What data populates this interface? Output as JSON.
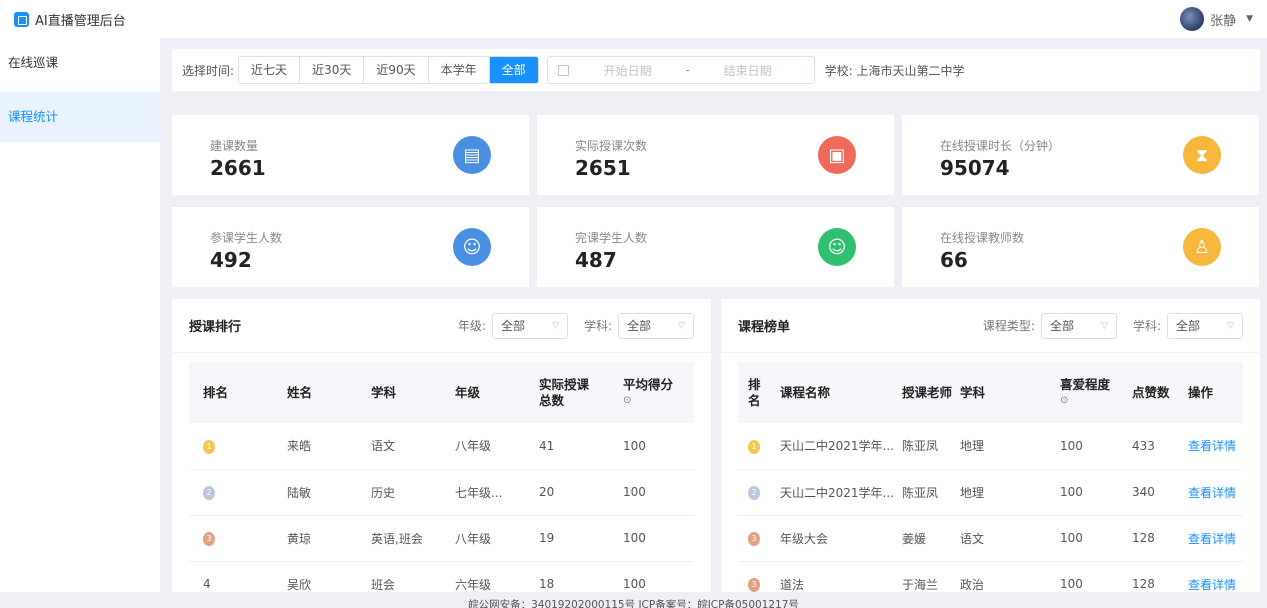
{
  "app": {
    "title": "AI直播管理后台"
  },
  "user": {
    "name": "张静"
  },
  "sidebar": {
    "items": [
      {
        "label": "在线巡课"
      },
      {
        "label": "课程统计"
      }
    ]
  },
  "filter": {
    "label": "选择时间:",
    "ranges": [
      "近七天",
      "近30天",
      "近90天",
      "本学年",
      "全部"
    ],
    "active_range": "全部",
    "start_placeholder": "开始日期",
    "separator": "-",
    "end_placeholder": "结束日期",
    "school": "学校: 上海市天山第二中学"
  },
  "stats": [
    {
      "label": "建课数量",
      "value": "2661",
      "icon": "document-icon",
      "color": "#4a90e2"
    },
    {
      "label": "实际授课次数",
      "value": "2651",
      "icon": "presentation-icon",
      "color": "#ef6a5a"
    },
    {
      "label": "在线授课时长（分钟）",
      "value": "95074",
      "icon": "hourglass-icon",
      "color": "#f6b73c"
    },
    {
      "label": "参课学生人数",
      "value": "492",
      "icon": "student-icon",
      "color": "#4a90e2"
    },
    {
      "label": "完课学生人数",
      "value": "487",
      "icon": "graduate-icon",
      "color": "#2fbf71"
    },
    {
      "label": "在线授课教师数",
      "value": "66",
      "icon": "teacher-icon",
      "color": "#f6b73c"
    }
  ],
  "ranking": {
    "title": "授课排行",
    "grade_label": "年级:",
    "grade_value": "全部",
    "subject_label": "学科:",
    "subject_value": "全部",
    "columns": [
      "排名",
      "姓名",
      "学科",
      "年级",
      "实际授课总数",
      "平均得分"
    ],
    "rows": [
      {
        "rank": "1",
        "name": "来皓",
        "subject": "语文",
        "grade": "八年级",
        "count": "41",
        "score": "100"
      },
      {
        "rank": "2",
        "name": "陆敏",
        "subject": "历史",
        "grade": "七年级...",
        "count": "20",
        "score": "100"
      },
      {
        "rank": "3",
        "name": "黄琼",
        "subject": "英语,班会",
        "grade": "八年级",
        "count": "19",
        "score": "100"
      },
      {
        "rank": "4",
        "name": "吴欣",
        "subject": "班会",
        "grade": "六年级",
        "count": "18",
        "score": "100"
      }
    ]
  },
  "courses": {
    "title": "课程榜单",
    "type_label": "课程类型:",
    "type_value": "全部",
    "subject_label": "学科:",
    "subject_value": "全部",
    "columns": [
      "排名",
      "课程名称",
      "授课老师",
      "学科",
      "喜爱程度",
      "点赞数",
      "操作"
    ],
    "rows": [
      {
        "rank": "1",
        "name": "天山二中2021学年...",
        "teacher": "陈亚凤",
        "subject": "地理",
        "likes_rate": "100",
        "likes": "433",
        "action": "查看详情"
      },
      {
        "rank": "2",
        "name": "天山二中2021学年...",
        "teacher": "陈亚凤",
        "subject": "地理",
        "likes_rate": "100",
        "likes": "340",
        "action": "查看详情"
      },
      {
        "rank": "3",
        "name": "年级大会",
        "teacher": "姜媛",
        "subject": "语文",
        "likes_rate": "100",
        "likes": "128",
        "action": "查看详情"
      },
      {
        "rank": "3",
        "name": "道法",
        "teacher": "于海兰",
        "subject": "政治",
        "likes_rate": "100",
        "likes": "128",
        "action": "查看详情"
      }
    ]
  },
  "footer": {
    "text": "皖公网安备：34019202000115号 ICP备案号：皖ICP备05001217号"
  }
}
